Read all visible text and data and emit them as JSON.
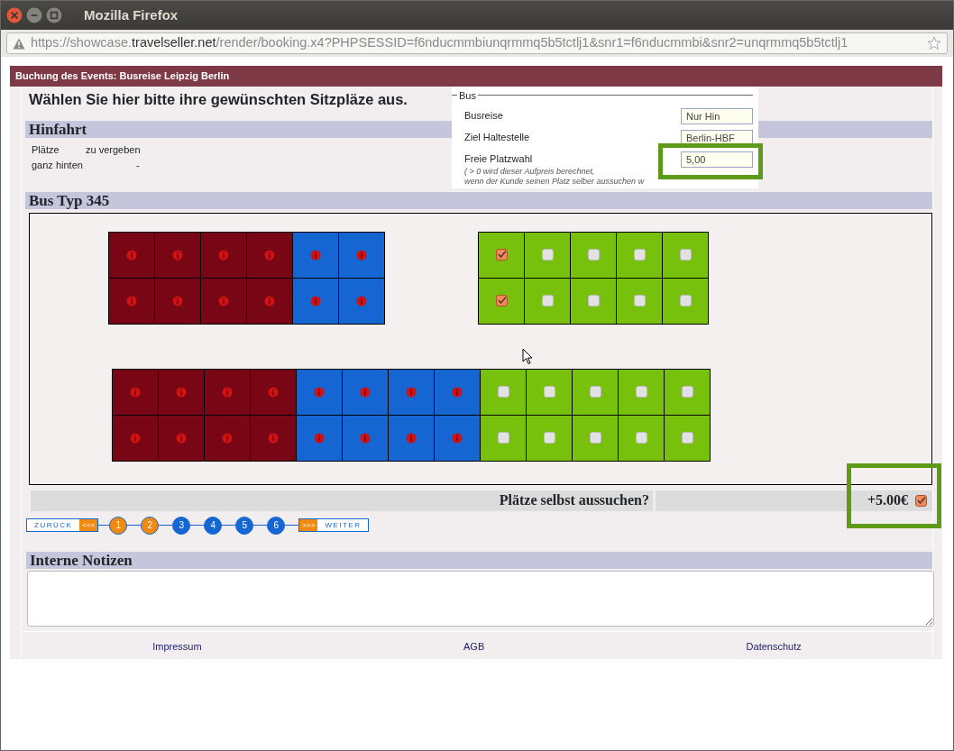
{
  "window": {
    "title": "Mozilla Firefox"
  },
  "address_bar": {
    "url_parts": [
      {
        "text": "https://showcase.",
        "emphasis": false
      },
      {
        "text": "travelseller.net",
        "emphasis": true
      },
      {
        "text": "/render/booking.x4?PHPSESSID=f6nducmmbiunqrmmq5b5tctlj1&snr1=f6nducmmbi&snr2=unqrmmq5b5tctlj1",
        "emphasis": false
      }
    ]
  },
  "page_header": "Buchung des Events: Busreise Leipzig Berlin",
  "heading": "Wählen Sie hier bitte ihre gewünschten Sitzpläze aus.",
  "hinfahrt": {
    "title": "Hinfahrt",
    "rows": [
      {
        "label": "Plätze",
        "value": "zu vergeben"
      },
      {
        "label": "ganz hinten",
        "value": "-"
      }
    ]
  },
  "bus_panel": {
    "legend": "Bus",
    "fields": [
      {
        "label": "Busreise",
        "value": "Nur Hin",
        "highlighted": false
      },
      {
        "label": "Ziel Haltestelle",
        "value": "Berlin-HBF",
        "highlighted": false
      },
      {
        "label": "Freie Platzwahl",
        "value": "5,00",
        "highlighted": true,
        "hint": "( > 0 wird dieser Aufpreis berechnet,",
        "hint_2": "wenn der Kunde seinen Platz selber aussuchen w"
      }
    ]
  },
  "bus_type": {
    "title": "Bus Typ 345",
    "seat_rows": [
      {
        "groups": [
          {
            "rows": [
              [
                {
                  "kind": "booked"
                },
                {
                  "kind": "booked"
                },
                {
                  "kind": "booked"
                },
                {
                  "kind": "booked"
                },
                {
                  "kind": "reserved"
                },
                {
                  "kind": "reserved"
                }
              ],
              [
                {
                  "kind": "booked"
                },
                {
                  "kind": "booked"
                },
                {
                  "kind": "booked"
                },
                {
                  "kind": "booked"
                },
                {
                  "kind": "reserved"
                },
                {
                  "kind": "reserved"
                }
              ]
            ]
          },
          {
            "rows": [
              [
                {
                  "kind": "free",
                  "checked": true
                },
                {
                  "kind": "free",
                  "checked": false
                },
                {
                  "kind": "free",
                  "checked": false
                },
                {
                  "kind": "free",
                  "checked": false
                },
                {
                  "kind": "free",
                  "checked": false
                }
              ],
              [
                {
                  "kind": "free",
                  "checked": true
                },
                {
                  "kind": "free",
                  "checked": false
                },
                {
                  "kind": "free",
                  "checked": false
                },
                {
                  "kind": "free",
                  "checked": false
                },
                {
                  "kind": "free",
                  "checked": false
                }
              ]
            ]
          }
        ]
      },
      {
        "groups": [
          {
            "rows": [
              [
                {
                  "kind": "booked"
                },
                {
                  "kind": "booked"
                },
                {
                  "kind": "booked"
                },
                {
                  "kind": "booked"
                },
                {
                  "kind": "reserved"
                },
                {
                  "kind": "reserved"
                },
                {
                  "kind": "reserved"
                },
                {
                  "kind": "reserved"
                },
                {
                  "kind": "free",
                  "checked": false
                },
                {
                  "kind": "free",
                  "checked": false
                },
                {
                  "kind": "free",
                  "checked": false
                },
                {
                  "kind": "free",
                  "checked": false
                },
                {
                  "kind": "free",
                  "checked": false
                }
              ],
              [
                {
                  "kind": "booked"
                },
                {
                  "kind": "booked"
                },
                {
                  "kind": "booked"
                },
                {
                  "kind": "booked"
                },
                {
                  "kind": "reserved"
                },
                {
                  "kind": "reserved"
                },
                {
                  "kind": "reserved"
                },
                {
                  "kind": "reserved"
                },
                {
                  "kind": "free",
                  "checked": false
                },
                {
                  "kind": "free",
                  "checked": false
                },
                {
                  "kind": "free",
                  "checked": false
                },
                {
                  "kind": "free",
                  "checked": false
                },
                {
                  "kind": "free",
                  "checked": false
                }
              ]
            ]
          }
        ]
      }
    ]
  },
  "self_select": {
    "label": "Plätze selbst aussuchen?",
    "price": "+5.00€",
    "checked": true,
    "highlighted": true
  },
  "wizard": {
    "back": {
      "label": "ZURÜCK",
      "arrows": "<<<"
    },
    "steps": [
      {
        "label": "1",
        "done": true
      },
      {
        "label": "2",
        "done": true
      },
      {
        "label": "3",
        "done": false
      },
      {
        "label": "4",
        "done": false
      },
      {
        "label": "5",
        "done": false
      },
      {
        "label": "6",
        "done": false
      }
    ],
    "next": {
      "label": "WEITER",
      "arrows": ">>>"
    }
  },
  "notes": {
    "title": "Interne Notizen"
  },
  "footer_links": [
    "Impressum",
    "AGB",
    "Datenschutz"
  ]
}
